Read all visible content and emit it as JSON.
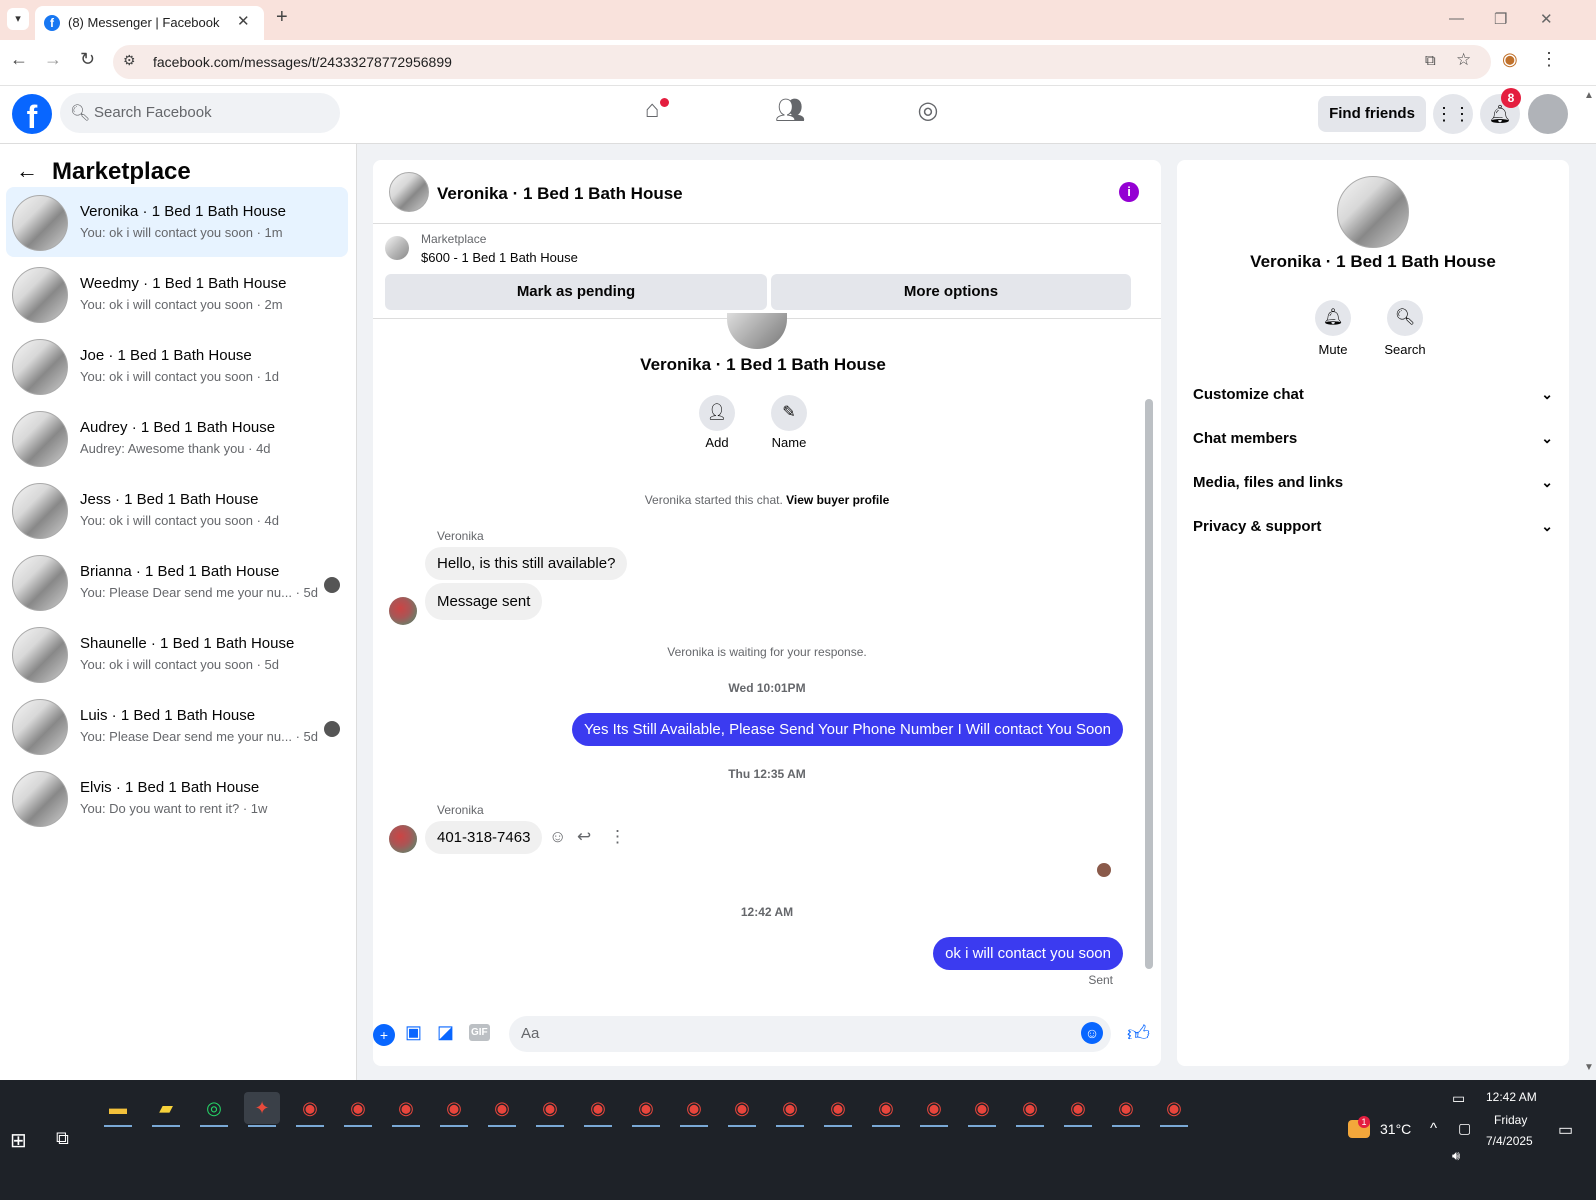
{
  "browser": {
    "tab_title": "(8) Messenger | Facebook",
    "tab_close": "✕",
    "new_tab": "+",
    "url": "facebook.com/messages/t/24333278772956899"
  },
  "fb": {
    "logo": "f",
    "search_placeholder": "Search Facebook",
    "find_friends": "Find friends",
    "notif_count": "8"
  },
  "left": {
    "title": "Marketplace",
    "conversations": [
      {
        "name": "Veronika · 1 Bed 1 Bath House",
        "preview": "You: ok i will contact you soon · 1m",
        "active": true
      },
      {
        "name": "Weedmy · 1 Bed 1 Bath House",
        "preview": "You: ok i will contact you soon · 2m"
      },
      {
        "name": "Joe · 1 Bed 1 Bath House",
        "preview": "You: ok i will contact you soon · 1d"
      },
      {
        "name": "Audrey · 1 Bed 1 Bath House",
        "preview": "Audrey: Awesome thank you · 4d"
      },
      {
        "name": "Jess · 1 Bed 1 Bath House",
        "preview": "You: ok i will contact you soon · 4d"
      },
      {
        "name": "Brianna · 1 Bed 1 Bath House",
        "preview": "You: Please Dear send me your nu... · 5d",
        "seen": true
      },
      {
        "name": "Shaunelle · 1 Bed 1 Bath House",
        "preview": "You: ok i will contact you soon · 5d"
      },
      {
        "name": "Luis · 1 Bed 1 Bath House",
        "preview": "You: Please Dear send me your nu... · 5d",
        "seen": true
      },
      {
        "name": "Elvis · 1 Bed 1 Bath House",
        "preview": "You: Do you want to rent it? · 1w"
      }
    ]
  },
  "chat": {
    "header_title": "Veronika · 1 Bed 1 Bath House",
    "marketplace_label": "Marketplace",
    "listing": "$600 - 1 Bed 1 Bath House",
    "mark_pending": "Mark as pending",
    "more_options": "More options",
    "intro_name": "Veronika · 1 Bed 1 Bath House",
    "add_label": "Add",
    "name_label": "Name",
    "started_text": "Veronika started this chat.",
    "buyer_profile_link": "View buyer profile",
    "sender_name": "Veronika",
    "msg1": "Hello, is this still available?",
    "msg2": "Message sent",
    "waiting": "Veronika is waiting for your response.",
    "time1": "Wed 10:01PM",
    "out1": "Yes Its Still Available, Please Send Your Phone Number I Will contact You Soon",
    "time2": "Thu 12:35 AM",
    "sender_name2": "Veronika",
    "msg3": "401-318-7463",
    "time3": "12:42 AM",
    "out2": "ok i will contact you soon",
    "sent_label": "Sent",
    "input_placeholder": "Aa"
  },
  "right": {
    "name": "Veronika · 1 Bed 1 Bath House",
    "mute": "Mute",
    "search": "Search",
    "sections": [
      "Customize chat",
      "Chat members",
      "Media, files and links",
      "Privacy & support"
    ]
  },
  "taskbar": {
    "temperature": "31°C",
    "time": "12:42 AM",
    "day": "Friday",
    "date": "7/4/2025",
    "weather_badge": "1"
  },
  "colors": {
    "fb_blue": "#0866ff",
    "outgoing_bubble": "#3b3bf0",
    "info_purple": "#9400d3",
    "badge_red": "#e41e3f"
  }
}
